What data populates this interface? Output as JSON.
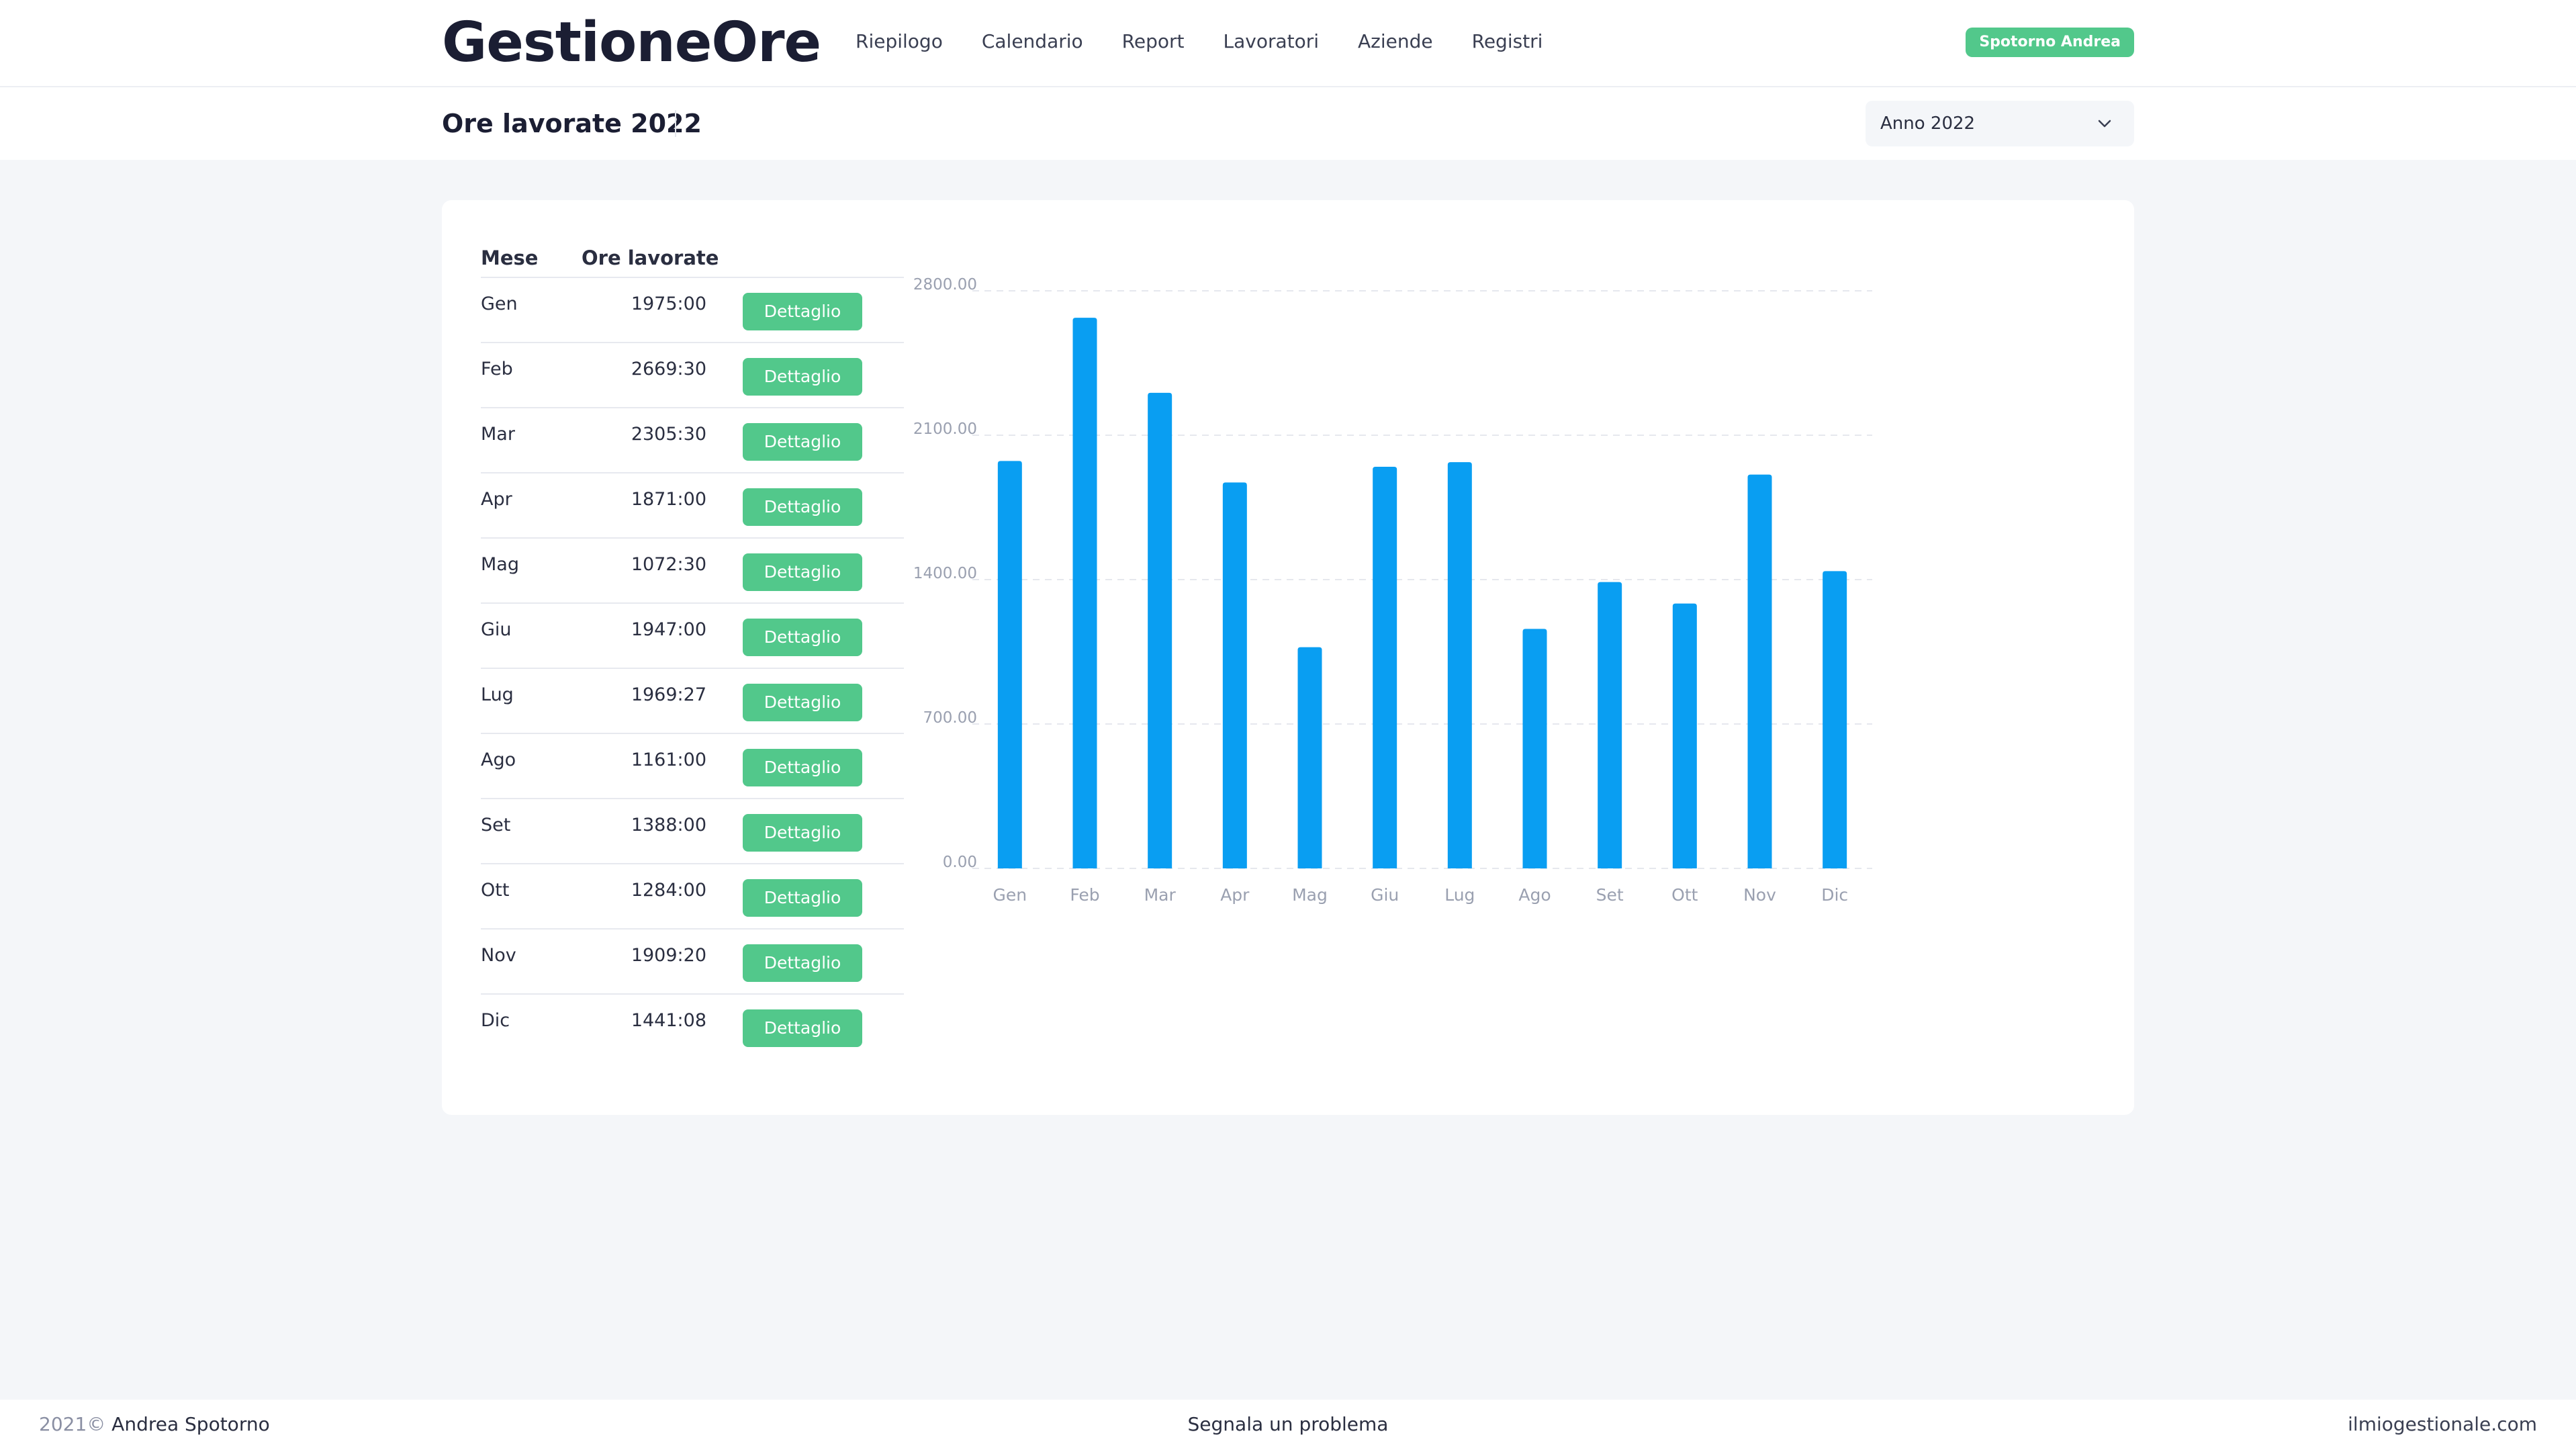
{
  "app": {
    "brand": "GestioneOre"
  },
  "nav": {
    "items": [
      {
        "label": "Riepilogo"
      },
      {
        "label": "Calendario"
      },
      {
        "label": "Report"
      },
      {
        "label": "Lavoratori"
      },
      {
        "label": "Aziende"
      },
      {
        "label": "Registri"
      }
    ]
  },
  "user": {
    "name": "Spotorno Andrea"
  },
  "page": {
    "title": "Ore lavorate 2022"
  },
  "year_select": {
    "value": "Anno 2022"
  },
  "table": {
    "headers": {
      "month": "Mese",
      "hours": "Ore lavorate"
    },
    "button_label": "Dettaglio",
    "rows": [
      {
        "month": "Gen",
        "hours": "1975:00"
      },
      {
        "month": "Feb",
        "hours": "2669:30"
      },
      {
        "month": "Mar",
        "hours": "2305:30"
      },
      {
        "month": "Apr",
        "hours": "1871:00"
      },
      {
        "month": "Mag",
        "hours": "1072:30"
      },
      {
        "month": "Giu",
        "hours": "1947:00"
      },
      {
        "month": "Lug",
        "hours": "1969:27"
      },
      {
        "month": "Ago",
        "hours": "1161:00"
      },
      {
        "month": "Set",
        "hours": "1388:00"
      },
      {
        "month": "Ott",
        "hours": "1284:00"
      },
      {
        "month": "Nov",
        "hours": "1909:20"
      },
      {
        "month": "Dic",
        "hours": "1441:08"
      }
    ]
  },
  "chart_data": {
    "type": "bar",
    "categories": [
      "Gen",
      "Feb",
      "Mar",
      "Apr",
      "Mag",
      "Giu",
      "Lug",
      "Ago",
      "Set",
      "Ott",
      "Nov",
      "Dic"
    ],
    "values": [
      1975,
      2669.5,
      2305.5,
      1871,
      1072.5,
      1947,
      1969.45,
      1161,
      1388,
      1284,
      1909.33,
      1441.13
    ],
    "yticks": [
      "0.00",
      "700.00",
      "1400.00",
      "2100.00",
      "2800.00"
    ],
    "ylim": [
      0,
      2800
    ],
    "grid": true,
    "legend": "none",
    "bar_color": "#099ef2",
    "grid_color": "#e6e8ee"
  },
  "footer": {
    "year": "2021©",
    "author": "Andrea Spotorno",
    "report_link": "Segnala un problema",
    "site": "ilmiogestionale.com"
  },
  "colors": {
    "accent_green": "#52c88b",
    "bar_blue": "#099ef2",
    "background": "#f4f6f9"
  }
}
